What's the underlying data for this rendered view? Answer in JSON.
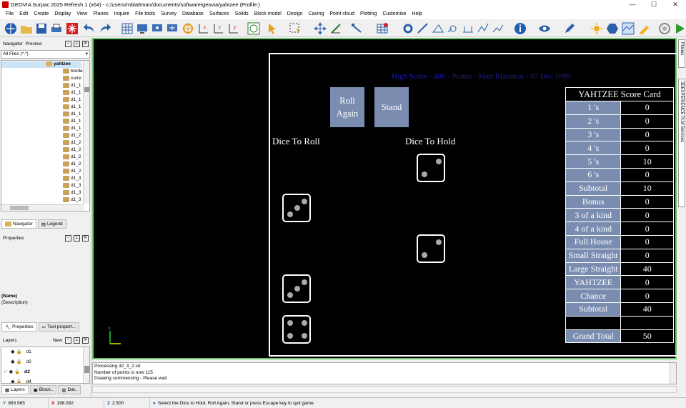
{
  "window": {
    "title": "GEOVIA Surpac 2025 Refresh 1 (x64) - c:/users/mblattman/documents/software/geovia/yahtzee (Profile:)",
    "controls": {
      "minimize": "—",
      "maximize": "☐",
      "close": "✕"
    }
  },
  "menu": [
    "File",
    "Edit",
    "Create",
    "Display",
    "View",
    "Planes",
    "Inquire",
    "File tools",
    "Survey",
    "Database",
    "Surfaces",
    "Solids",
    "Block model",
    "Design",
    "Caving",
    "Point cloud",
    "Plotting",
    "Customise",
    "Help"
  ],
  "navigator": {
    "tabs": [
      "Navigator",
      "Preview"
    ],
    "filter": "All Files (*.*)",
    "root": "yahtzee",
    "items": [
      "borde",
      "curre",
      "d1_1",
      "d1_1",
      "d1_1",
      "d1_1",
      "d1_1",
      "d1_1",
      "d1_1",
      "d1_2",
      "d1_2",
      "d1_2",
      "d1_2",
      "d1_2",
      "d1_2",
      "d1_3",
      "d1_3",
      "d1_3",
      "d1_3",
      "d1_3"
    ],
    "bottom_tabs": [
      "Navigator",
      "Legend"
    ]
  },
  "properties": {
    "title": "Properties",
    "name": "(Name)",
    "description": "(Description)",
    "bottom_tabs": [
      "Properties",
      "Tool propert..."
    ]
  },
  "layers": {
    "title": "Layers",
    "new_label": "New",
    "items": [
      "d1",
      "d2",
      "d3",
      "d4"
    ],
    "bottom_tabs": [
      "Layers",
      "Block..",
      "Dat.."
    ]
  },
  "right_tabs": [
    "Planes",
    "3DEXPERIENCE PLM Services"
  ],
  "game": {
    "high_score": "High Score - 400 - Points - Matt Blattman - 07 Dec 1999",
    "roll_button": "Roll Again",
    "roll_line1": "Roll",
    "roll_line2": "Again",
    "stand_button": "Stand",
    "dice_to_roll": "Dice To Roll",
    "dice_to_hold": "Dice To Hold",
    "dice_roll": [
      3,
      3,
      4
    ],
    "dice_hold": [
      2,
      2
    ],
    "axis_labels": {
      "y": "Y",
      "x": "X"
    }
  },
  "scorecard": {
    "title": "YAHTZEE Score Card",
    "rows": [
      {
        "label": "1 's",
        "value": "0"
      },
      {
        "label": "2 's",
        "value": "0"
      },
      {
        "label": "3 's",
        "value": "0"
      },
      {
        "label": "4 's",
        "value": "0"
      },
      {
        "label": "5 's",
        "value": "10"
      },
      {
        "label": "6 's",
        "value": "0"
      },
      {
        "label": "Subtotal",
        "value": "10"
      },
      {
        "label": "Bonus",
        "value": "0"
      },
      {
        "label": "3 of a kind",
        "value": "0"
      },
      {
        "label": "4 of a kind",
        "value": "0"
      },
      {
        "label": "Full House",
        "value": "0"
      },
      {
        "label": "Small Straight",
        "value": "0"
      },
      {
        "label": "Large Straight",
        "value": "40"
      },
      {
        "label": "YAHTZEE",
        "value": "0"
      },
      {
        "label": "Chance",
        "value": "0"
      },
      {
        "label": "Subtotal",
        "value": "40"
      },
      {
        "label": "",
        "value": ""
      }
    ],
    "grand_total_label": "Grand Total",
    "grand_total": "50"
  },
  "messages": [
    "Processing d2_3_2.str",
    "Number of points is now 115",
    "Drawing commencing - Please wait"
  ],
  "status": {
    "y": "883.985",
    "x": "198.092",
    "z": "2.500",
    "prompt": "Select the Dice to Hold, Roll Again, Stand or press Escape key to quit game"
  },
  "colors": {
    "viewport_bg": "#000000",
    "viewport_border": "#6cc66c",
    "button": "#7a8db0",
    "high_score": "#1b1ba8"
  }
}
